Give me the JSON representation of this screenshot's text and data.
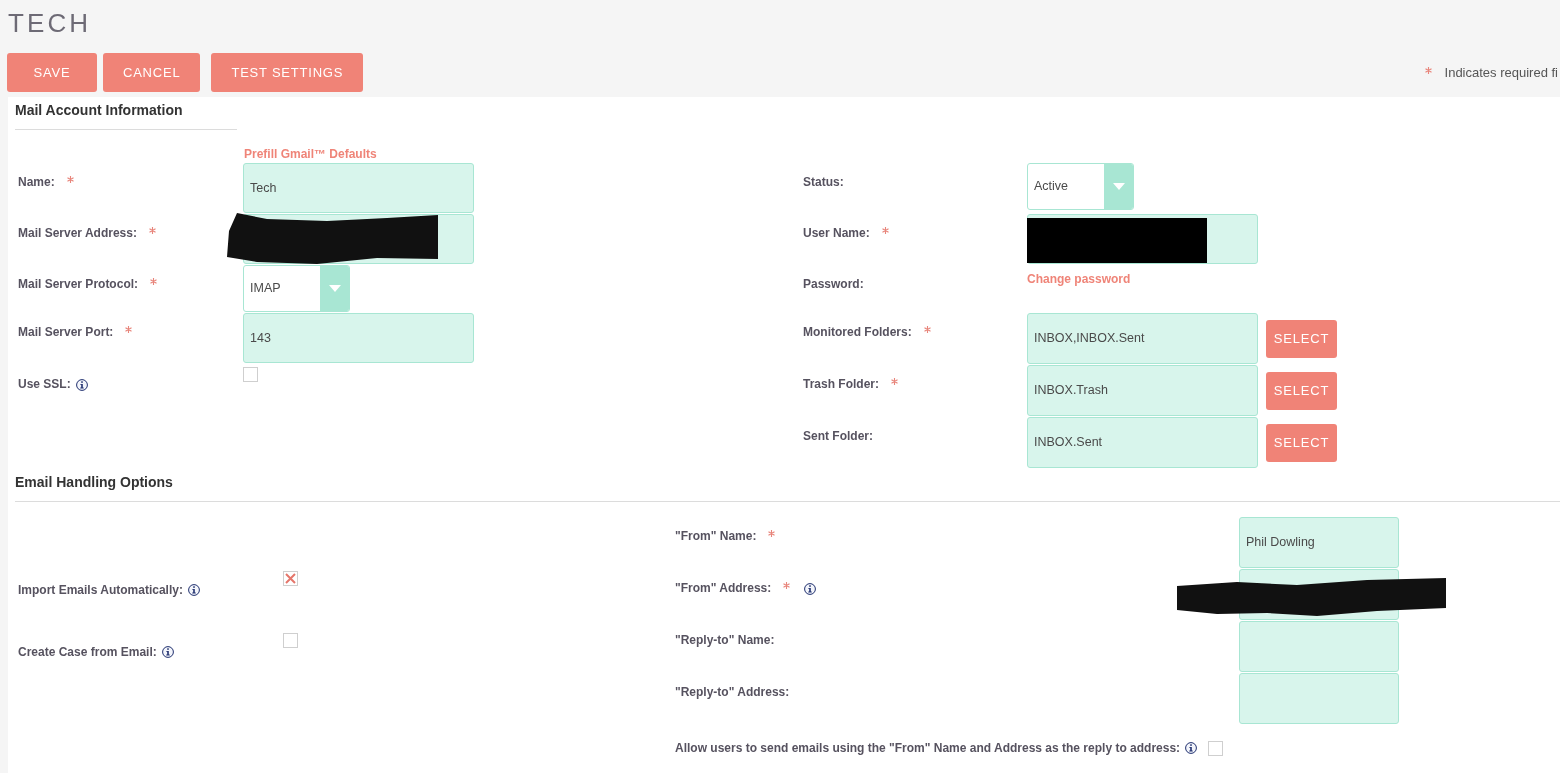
{
  "page": {
    "title": "TECH"
  },
  "actions": [
    {
      "label": "SAVE"
    },
    {
      "label": "CANCEL"
    },
    {
      "label": "TEST SETTINGS"
    }
  ],
  "required_note": {
    "text": "Indicates required fi"
  },
  "mail_account": {
    "heading": "Mail Account Information",
    "prefill_link": "Prefill Gmail™ Defaults",
    "left_fields": [
      {
        "kind": "text",
        "label": "Name:",
        "required": true,
        "info": false,
        "value": "Tech",
        "redacted": false
      },
      {
        "kind": "text",
        "label": "Mail Server Address:",
        "required": true,
        "info": false,
        "redacted": true
      },
      {
        "kind": "select",
        "label": "Mail Server Protocol:",
        "required": true,
        "info": false,
        "value": "IMAP"
      },
      {
        "kind": "text",
        "label": "Mail Server Port:",
        "required": true,
        "info": false,
        "value": "143",
        "redacted": false
      },
      {
        "kind": "checkbox",
        "label": "Use SSL:",
        "required": false,
        "info": true,
        "checked": false
      }
    ],
    "right_fields": [
      {
        "kind": "select",
        "label": "Status:",
        "required": false,
        "info": false,
        "value": "Active"
      },
      {
        "kind": "text",
        "label": "User Name:",
        "required": true,
        "info": false,
        "redacted": true
      },
      {
        "kind": "link",
        "label": "Password:",
        "required": false,
        "info": false,
        "link": "Change password"
      },
      {
        "kind": "folder",
        "label": "Monitored Folders:",
        "required": true,
        "info": false,
        "value": "INBOX,INBOX.Sent",
        "button": "SELECT"
      },
      {
        "kind": "folder",
        "label": "Trash Folder:",
        "required": true,
        "info": false,
        "value": "INBOX.Trash",
        "button": "SELECT"
      },
      {
        "kind": "folder",
        "label": "Sent Folder:",
        "required": false,
        "info": false,
        "value": "INBOX.Sent",
        "button": "SELECT"
      }
    ]
  },
  "email_handling": {
    "heading": "Email Handling Options",
    "options": [
      {
        "label": "Import Emails Automatically:",
        "info": true,
        "checked": true
      },
      {
        "label": "Create Case from Email:",
        "info": true,
        "checked": false
      }
    ],
    "sender_fields": [
      {
        "label": "\"From\" Name:",
        "required": true,
        "info": false,
        "value": "Phil Dowling",
        "redacted": false
      },
      {
        "label": "\"From\" Address:",
        "required": true,
        "info": true,
        "redacted": true
      },
      {
        "label": "\"Reply-to\" Name:",
        "required": false,
        "info": false,
        "redacted": false
      },
      {
        "label": "\"Reply-to\" Address:",
        "required": false,
        "info": false,
        "redacted": false
      }
    ],
    "reply_to_option": {
      "label": "Allow users to send emails using the \"From\" Name and Address as the reply to address:",
      "info": true,
      "checked": false
    }
  }
}
